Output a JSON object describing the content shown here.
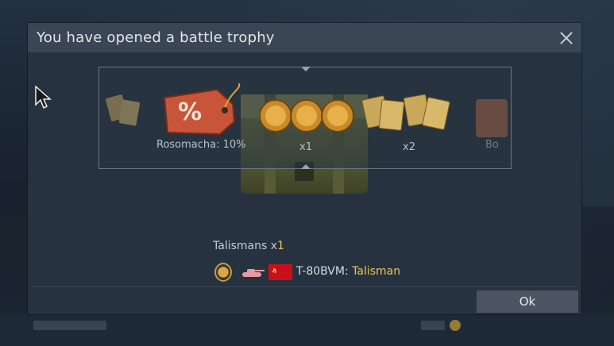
{
  "dialog": {
    "title": "You have opened a battle trophy",
    "close_icon": "close-icon"
  },
  "roulette": {
    "items": [
      {
        "icon": "talisman-cards-icon",
        "label": ""
      },
      {
        "icon": "discount-tag-icon",
        "label": "Rosomacha: 10%"
      },
      {
        "icon": "talisman-medals-icon",
        "label": "x1"
      },
      {
        "icon": "talisman-cards-icon",
        "label": "x2"
      },
      {
        "icon": "booster-icon",
        "label": "Bo"
      }
    ]
  },
  "reward": {
    "title_prefix": "Talismans x",
    "title_count": "1",
    "vehicle_name": "T-80BVM:",
    "vehicle_bonus": "Talisman",
    "nation": "USSR",
    "icons": [
      "talisman-medal-icon",
      "tank-icon",
      "ussr-flag-icon"
    ]
  },
  "buttons": {
    "ok": "Ok"
  },
  "colors": {
    "accent_gold": "#e6c65a",
    "dialog_bg": "#26323f",
    "titlebar_bg": "#3a4654",
    "flag_red": "#c8101a"
  }
}
